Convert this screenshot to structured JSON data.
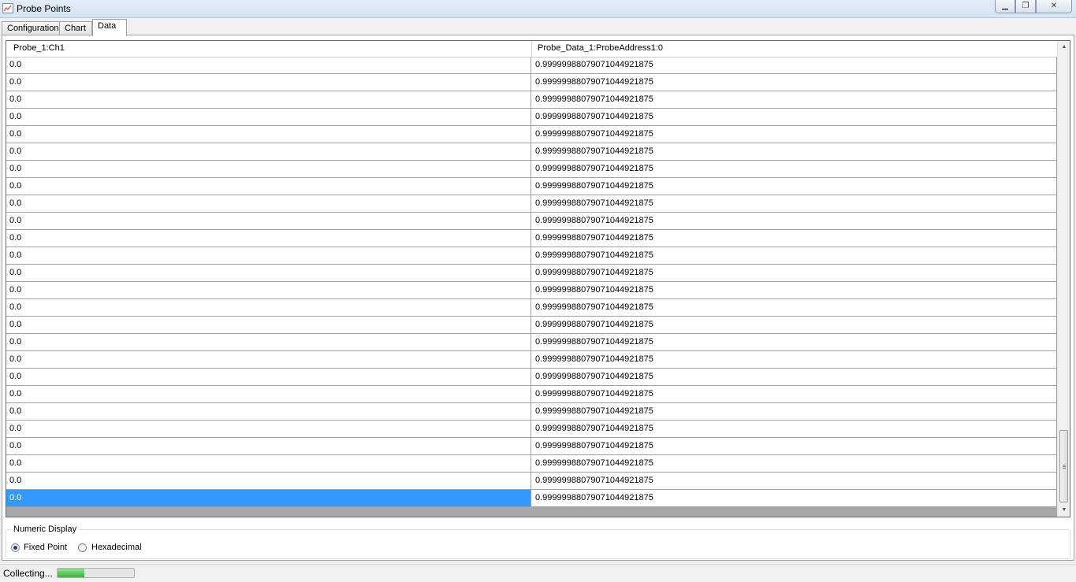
{
  "window": {
    "title": "Probe Points",
    "minimize_icon": "minimize-icon",
    "maximize_icon": "restore-icon",
    "close_icon": "close-icon"
  },
  "tabs": [
    {
      "label": "Configuration",
      "active": false
    },
    {
      "label": "Chart",
      "active": false
    },
    {
      "label": "Data",
      "active": true
    }
  ],
  "table": {
    "columns": [
      "Probe_1:Ch1",
      "Probe_Data_1:ProbeAddress1:0"
    ],
    "rows": [
      [
        "0.0",
        "0.999999880790710449218​75"
      ],
      [
        "0.0",
        "0.99999988079071044921875"
      ],
      [
        "0.0",
        "0.99999988079071044921875"
      ],
      [
        "0.0",
        "0.99999988079071044921875"
      ],
      [
        "0.0",
        "0.99999988079071044921875"
      ],
      [
        "0.0",
        "0.99999988079071044921875"
      ],
      [
        "0.0",
        "0.99999988079071044921875"
      ],
      [
        "0.0",
        "0.99999988079071044921875"
      ],
      [
        "0.0",
        "0.99999988079071044921875"
      ],
      [
        "0.0",
        "0.99999988079071044921875"
      ],
      [
        "0.0",
        "0.99999988079071044921875"
      ],
      [
        "0.0",
        "0.99999988079071044921875"
      ],
      [
        "0.0",
        "0.99999988079071044921875"
      ],
      [
        "0.0",
        "0.99999988079071044921875"
      ],
      [
        "0.0",
        "0.99999988079071044921875"
      ],
      [
        "0.0",
        "0.99999988079071044921875"
      ],
      [
        "0.0",
        "0.99999988079071044921875"
      ],
      [
        "0.0",
        "0.99999988079071044921875"
      ],
      [
        "0.0",
        "0.99999988079071044921875"
      ],
      [
        "0.0",
        "0.99999988079071044921875"
      ],
      [
        "0.0",
        "0.99999988079071044921875"
      ],
      [
        "0.0",
        "0.99999988079071044921875"
      ],
      [
        "0.0",
        "0.99999988079071044921875"
      ],
      [
        "0.0",
        "0.99999988079071044921875"
      ],
      [
        "0.0",
        "0.99999988079071044921875"
      ],
      [
        "0.0",
        "0.99999988079071044921875"
      ]
    ],
    "selected_row": 25,
    "selection_color": "#3399ff"
  },
  "numeric_display": {
    "legend": "Numeric Display",
    "options": [
      {
        "label": "Fixed Point",
        "checked": true
      },
      {
        "label": "Hexadecimal",
        "checked": false
      }
    ]
  },
  "status": {
    "text": "Collecting...",
    "progress": 0.35
  }
}
